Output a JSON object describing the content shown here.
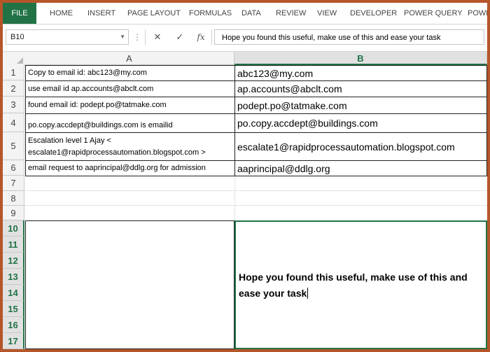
{
  "ribbon": {
    "tabs": [
      "FILE",
      "HOME",
      "INSERT",
      "PAGE LAYOUT",
      "FORMULAS",
      "DATA",
      "REVIEW",
      "VIEW",
      "DEVELOPER",
      "POWER QUERY",
      "POWE"
    ]
  },
  "formula_bar": {
    "name_box": "B10",
    "dots": "⋮",
    "cancel_icon": "✕",
    "enter_icon": "✓",
    "fx_label": "fx",
    "content": "Hope you found this useful, make use of this and ease your task"
  },
  "grid": {
    "columns": [
      "A",
      "B"
    ],
    "rows": [
      "1",
      "2",
      "3",
      "4",
      "5",
      "6",
      "7",
      "8",
      "9",
      "10",
      "11",
      "12",
      "13",
      "14",
      "15",
      "16",
      "17"
    ],
    "cells": [
      {
        "a": "Copy to email id: abc123@my.com",
        "b": "abc123@my.com"
      },
      {
        "a": "use email id ap.accounts@abclt.com",
        "b": "ap.accounts@abclt.com"
      },
      {
        "a": "found email id: podept.po@tatmake.com",
        "b": "podept.po@tatmake.com"
      },
      {
        "a": "po.copy.accdept@buildings.com is emailid",
        "b": "po.copy.accdept@buildings.com"
      },
      {
        "a": "Escalation level 1 Ajay  <\nescalate1@rapidprocessautomation.blogspot.com >",
        "b": "escalate1@rapidprocessautomation.blogspot.com"
      },
      {
        "a": "email request to aaprincipal@ddlg.org for admission",
        "b": "aaprincipal@ddlg.org"
      }
    ],
    "row5_line1": "Escalation level 1 Ajay  <",
    "row5_line2": "escalate1@rapidprocessautomation.blogspot.com >",
    "selected_cell": "B10",
    "selected_text": "Hope you found this useful, make use of this and ease your task"
  },
  "colors": {
    "accent": "#217346",
    "frame": "#b5562a"
  }
}
